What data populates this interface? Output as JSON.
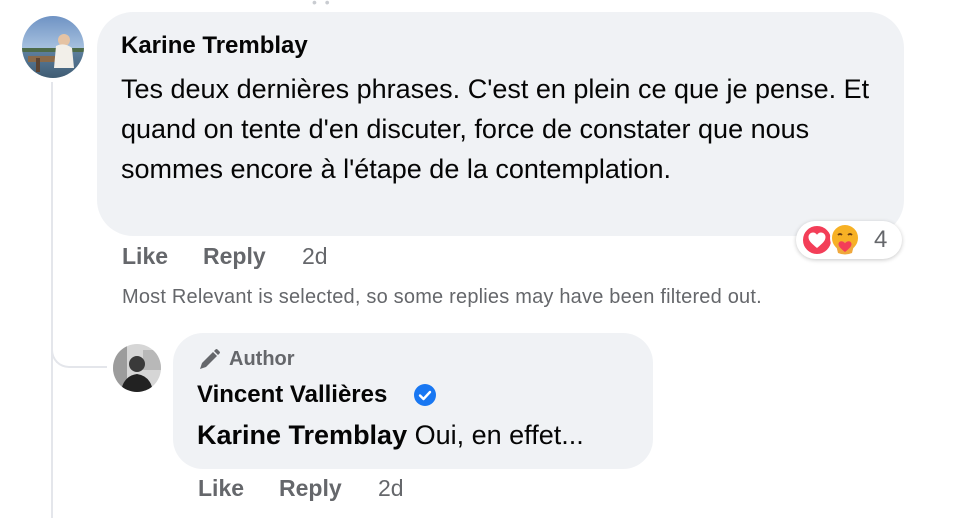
{
  "comment": {
    "author": "Karine Tremblay",
    "text": "Tes deux dernières phrases. C'est en plein ce que je pense. Et quand on tente d'en discuter, force de constater que nous sommes encore à l'étape de la contemplation.",
    "reactions": {
      "types": [
        "heart-icon",
        "care-icon"
      ],
      "count": "4"
    },
    "actions": {
      "like": "Like",
      "reply": "Reply",
      "time": "2d"
    }
  },
  "filter_notice": "Most Relevant is selected, so some replies may have been filtered out.",
  "reply": {
    "badge": "Author",
    "author": "Vincent Vallières",
    "verified": true,
    "mention": "Karine Tremblay",
    "text": "Oui, en effet...",
    "actions": {
      "like": "Like",
      "reply": "Reply",
      "time": "2d"
    }
  },
  "colors": {
    "bubble": "#f0f2f5",
    "secondary_text": "#65676b",
    "verified": "#1877f2",
    "heart": "#f33e58",
    "care": "#f7b125"
  }
}
